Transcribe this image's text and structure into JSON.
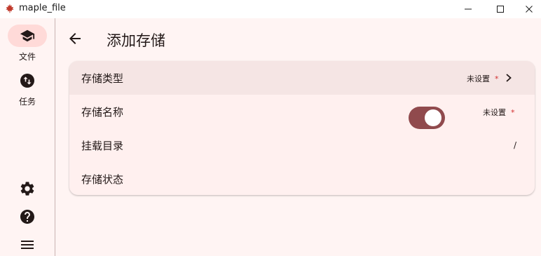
{
  "window": {
    "title": "maple_file",
    "logo_icon": "maple-leaf-icon",
    "controls": [
      "minimize-icon",
      "maximize-icon",
      "close-icon"
    ]
  },
  "rail": {
    "items": [
      {
        "label": "文件",
        "icon": "school-icon",
        "selected": true
      },
      {
        "label": "任务",
        "icon": "swap-vert-circle-icon",
        "selected": false
      }
    ],
    "bottom_icons": [
      "settings-icon",
      "help-icon",
      "menu-icon"
    ]
  },
  "page": {
    "title": "添加存储",
    "back_icon": "arrow-back-icon"
  },
  "form": {
    "rows": [
      {
        "title": "存储类型",
        "value": "未设置",
        "required_mark": "*",
        "has_chevron": true
      },
      {
        "title": "存储名称",
        "value": "未设置",
        "required_mark": "*",
        "has_chevron": false
      },
      {
        "title": "挂载目录",
        "value": "/"
      },
      {
        "title": "存储状态",
        "toggle_on": true
      }
    ]
  },
  "colors": {
    "background": "#fff4f3",
    "rail_selected_pill": "#ffdad8",
    "card": "#fff0ef",
    "switch_on": "#904a4d",
    "required": "#d32f2f",
    "logo": "#c0392b"
  }
}
